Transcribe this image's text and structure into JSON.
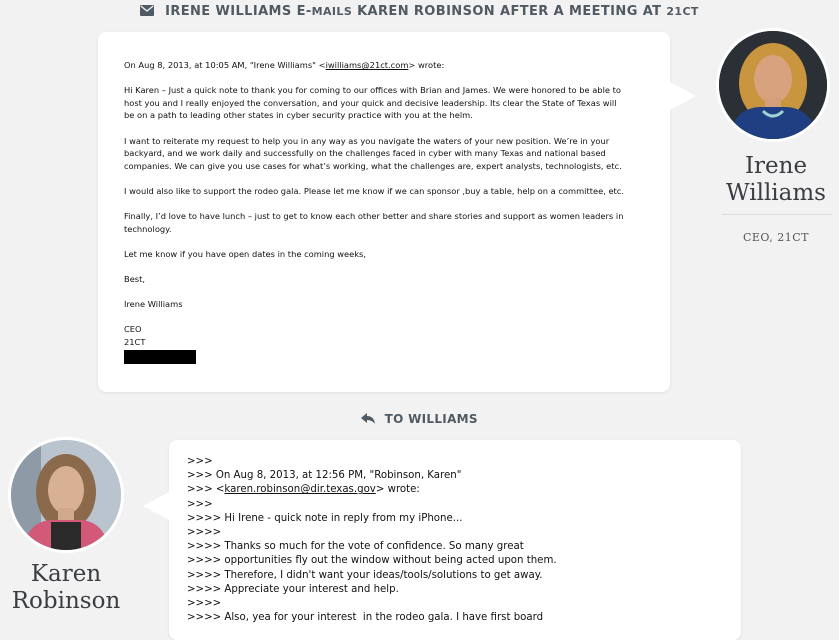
{
  "header": {
    "icon": "envelope-icon",
    "pre": "Irene Williams e-",
    "pre_small": "mails",
    "mid": " Karen Robinson after a meeting at ",
    "org": "21ct"
  },
  "email1": {
    "lines": [
      "On Aug 8, 2013, at 10:05 AM, \"Irene Williams\" <",
      "iwilliams@21ct.com",
      "> wrote:"
    ],
    "body": [
      [
        "Hi Karen – Just a quick note to thank you for coming to our offices with Brian and James.  We were honored to be able to",
        "host you and I really enjoyed the conversation, and your quick and decisive leadership.  Its clear the State of Texas will",
        "be on a path to leading other states in cyber security practice with you at the helm."
      ],
      [
        "I want to reiterate my request to help you in any way as you navigate the waters of your new position.  We’re in your",
        "backyard, and we work daily and successfully on the challenges faced in cyber with many Texas and national based",
        "companies.  We can give you use cases for what’s working, what the challenges are, expert analysts, technologists, etc."
      ],
      [
        "I would also like to support the rodeo gala. Please let me know if we can sponsor ,buy a table, help on a committee, etc."
      ],
      [
        "Finally, I’d love to have lunch – just to get to know each other better and share stories and support as women leaders in",
        "technology."
      ],
      [
        "Let me know if you have open dates in the coming weeks,"
      ],
      [
        "Best,"
      ],
      [
        "Irene Williams"
      ]
    ],
    "sig_title": "CEO",
    "sig_org": "21CT"
  },
  "sender": {
    "name_first": "Irene",
    "name_last": "Williams",
    "title": "CEO, 21CT"
  },
  "reply_header": {
    "icon": "reply-icon",
    "label": "TO WILLIAMS"
  },
  "email2": {
    "lines": [
      ">>>",
      ">>> On Aug 8, 2013, at 12:56 PM, \"Robinson, Karen\"",
      ">>> <",
      "karen.robinson@dir.texas.gov",
      "> wrote:",
      ">>>",
      ">>>> Hi Irene - quick note in reply from my iPhone...",
      ">>>>",
      ">>>> Thanks so much for the vote of confidence. So many great",
      ">>>> opportunities fly out the window without being acted upon them.",
      ">>>> Therefore, I didn't want your ideas/tools/solutions to get away.",
      ">>>> Appreciate your interest and help.",
      ">>>>",
      ">>>> Also, yea for your interest  in the rodeo gala. I have first board"
    ]
  },
  "recipient": {
    "name_first": "Karen",
    "name_last": "Robinson"
  },
  "colors": {
    "background": "#f2f2f2",
    "card": "#ffffff",
    "header_text": "#505a62"
  }
}
